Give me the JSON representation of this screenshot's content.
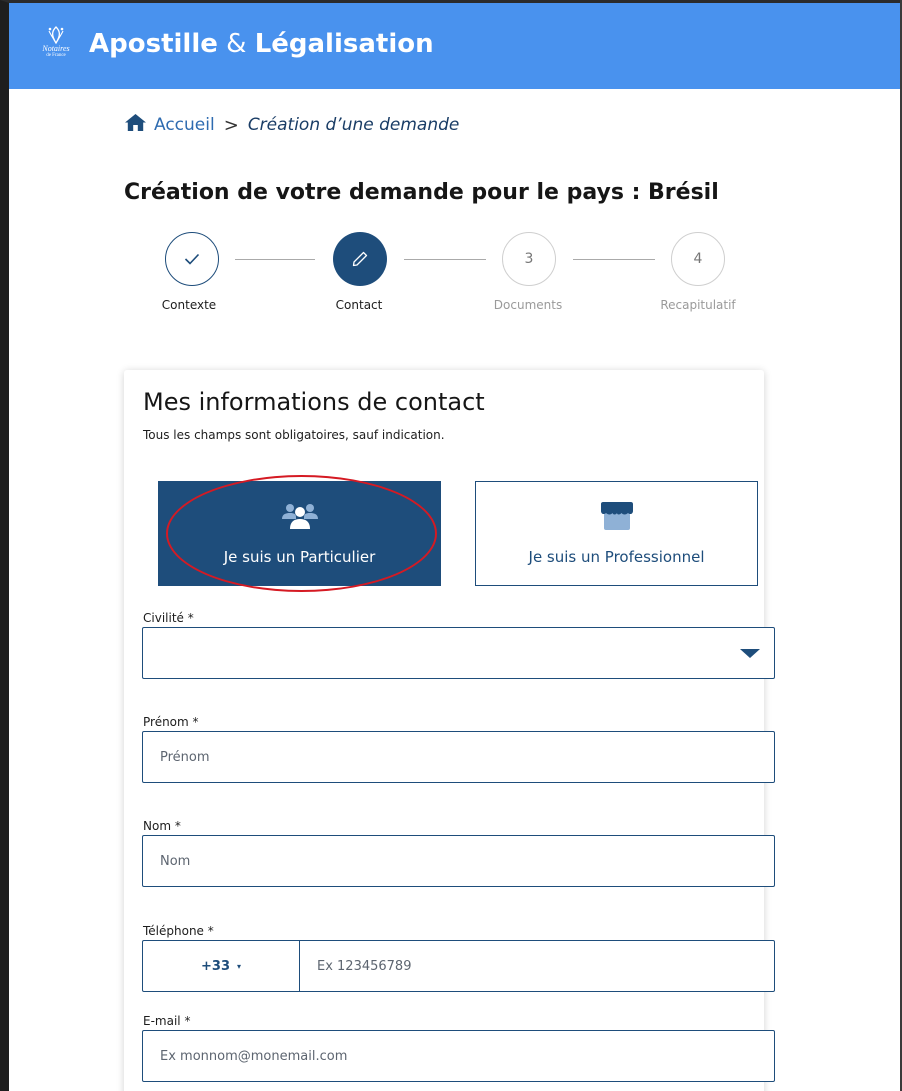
{
  "header": {
    "logo_text": "Notaires",
    "logo_sub": "de France",
    "title_part1": "Apostille",
    "title_amp": "&",
    "title_part2": "Légalisation"
  },
  "breadcrumb": {
    "home_label": "Accueil",
    "separator": ">",
    "current": "Création d’une demande"
  },
  "page_title": "Création de votre demande pour le pays : Brésil",
  "stepper": {
    "steps": [
      {
        "number": "",
        "label": "Contexte",
        "state": "done"
      },
      {
        "number": "",
        "label": "Contact",
        "state": "active"
      },
      {
        "number": "3",
        "label": "Documents",
        "state": "todo"
      },
      {
        "number": "4",
        "label": "Recapitulatif",
        "state": "todo"
      }
    ]
  },
  "form": {
    "title": "Mes informations de contact",
    "subtitle": "Tous les champs sont obligatoires, sauf indication.",
    "choices": {
      "particulier": "Je suis un Particulier",
      "professionnel": "Je suis un Professionnel",
      "selected": "particulier"
    },
    "civilite": {
      "label": "Civilité *",
      "value": ""
    },
    "prenom": {
      "label": "Prénom *",
      "placeholder": "Prénom"
    },
    "nom": {
      "label": "Nom *",
      "placeholder": "Nom"
    },
    "telephone": {
      "label": "Téléphone *",
      "country_code": "+33",
      "placeholder": "Ex 123456789"
    },
    "email": {
      "label": "E-mail *",
      "placeholder": "Ex monnom@monemail.com"
    }
  },
  "colors": {
    "header_bg": "#4992ee",
    "primary": "#1e4d7b",
    "highlight_ring": "#d51a23"
  }
}
